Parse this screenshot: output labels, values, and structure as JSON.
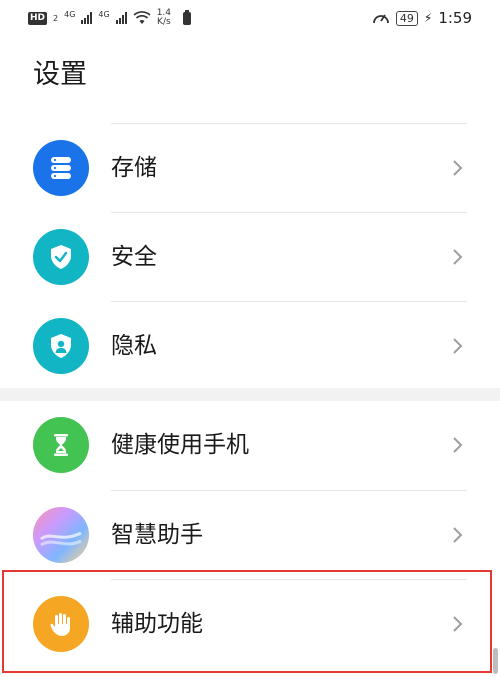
{
  "status_bar": {
    "hd": "HD",
    "hd_sub": "2",
    "sig1_label": "4G",
    "sig2_label": "4G",
    "net_speed_value": "1.4",
    "net_speed_unit": "K/s",
    "battery_level": "49",
    "time": "1:59"
  },
  "page": {
    "title": "设置"
  },
  "items": [
    {
      "label": "存储",
      "icon": "storage-icon",
      "color": "#1a73e8"
    },
    {
      "label": "安全",
      "icon": "shield-check-icon",
      "color": "#12b5c3"
    },
    {
      "label": "隐私",
      "icon": "privacy-icon",
      "color": "#12b5c3"
    },
    {
      "label": "健康使用手机",
      "icon": "hourglass-icon",
      "color": "#43c352"
    },
    {
      "label": "智慧助手",
      "icon": "assistant-icon",
      "color": "#b892ff"
    },
    {
      "label": "辅助功能",
      "icon": "hand-icon",
      "color": "#f5a623"
    }
  ]
}
